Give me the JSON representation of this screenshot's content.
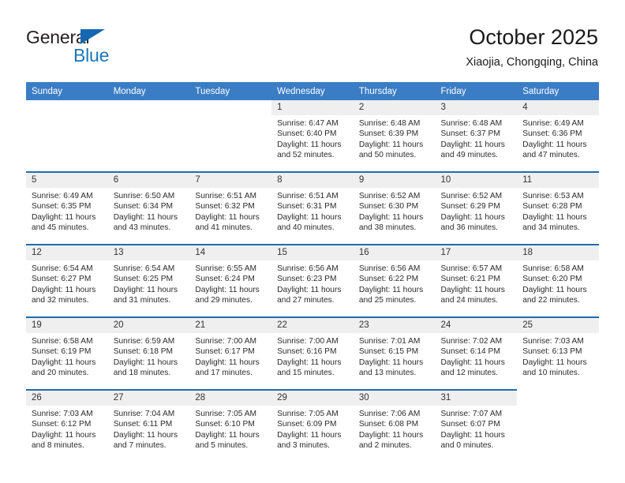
{
  "brand": {
    "name_part1": "General",
    "name_part2": "Blue",
    "triangle_color": "#1667b2",
    "blue_color": "#1b75bb"
  },
  "header": {
    "title": "October 2025",
    "location": "Xiaojia, Chongqing, China"
  },
  "theme": {
    "header_row_bg": "#3b7dc4",
    "week_divider": "#1f6cb0",
    "day_number_bg": "#efefef",
    "text": "#2b2b2b"
  },
  "weekday_headers": [
    "Sunday",
    "Monday",
    "Tuesday",
    "Wednesday",
    "Thursday",
    "Friday",
    "Saturday"
  ],
  "weeks": [
    [
      {
        "empty": true
      },
      {
        "empty": true
      },
      {
        "empty": true
      },
      {
        "day": "1",
        "sunrise": "Sunrise: 6:47 AM",
        "sunset": "Sunset: 6:40 PM",
        "daylight_line1": "Daylight: 11 hours",
        "daylight_line2": "and 52 minutes."
      },
      {
        "day": "2",
        "sunrise": "Sunrise: 6:48 AM",
        "sunset": "Sunset: 6:39 PM",
        "daylight_line1": "Daylight: 11 hours",
        "daylight_line2": "and 50 minutes."
      },
      {
        "day": "3",
        "sunrise": "Sunrise: 6:48 AM",
        "sunset": "Sunset: 6:37 PM",
        "daylight_line1": "Daylight: 11 hours",
        "daylight_line2": "and 49 minutes."
      },
      {
        "day": "4",
        "sunrise": "Sunrise: 6:49 AM",
        "sunset": "Sunset: 6:36 PM",
        "daylight_line1": "Daylight: 11 hours",
        "daylight_line2": "and 47 minutes."
      }
    ],
    [
      {
        "day": "5",
        "sunrise": "Sunrise: 6:49 AM",
        "sunset": "Sunset: 6:35 PM",
        "daylight_line1": "Daylight: 11 hours",
        "daylight_line2": "and 45 minutes."
      },
      {
        "day": "6",
        "sunrise": "Sunrise: 6:50 AM",
        "sunset": "Sunset: 6:34 PM",
        "daylight_line1": "Daylight: 11 hours",
        "daylight_line2": "and 43 minutes."
      },
      {
        "day": "7",
        "sunrise": "Sunrise: 6:51 AM",
        "sunset": "Sunset: 6:32 PM",
        "daylight_line1": "Daylight: 11 hours",
        "daylight_line2": "and 41 minutes."
      },
      {
        "day": "8",
        "sunrise": "Sunrise: 6:51 AM",
        "sunset": "Sunset: 6:31 PM",
        "daylight_line1": "Daylight: 11 hours",
        "daylight_line2": "and 40 minutes."
      },
      {
        "day": "9",
        "sunrise": "Sunrise: 6:52 AM",
        "sunset": "Sunset: 6:30 PM",
        "daylight_line1": "Daylight: 11 hours",
        "daylight_line2": "and 38 minutes."
      },
      {
        "day": "10",
        "sunrise": "Sunrise: 6:52 AM",
        "sunset": "Sunset: 6:29 PM",
        "daylight_line1": "Daylight: 11 hours",
        "daylight_line2": "and 36 minutes."
      },
      {
        "day": "11",
        "sunrise": "Sunrise: 6:53 AM",
        "sunset": "Sunset: 6:28 PM",
        "daylight_line1": "Daylight: 11 hours",
        "daylight_line2": "and 34 minutes."
      }
    ],
    [
      {
        "day": "12",
        "sunrise": "Sunrise: 6:54 AM",
        "sunset": "Sunset: 6:27 PM",
        "daylight_line1": "Daylight: 11 hours",
        "daylight_line2": "and 32 minutes."
      },
      {
        "day": "13",
        "sunrise": "Sunrise: 6:54 AM",
        "sunset": "Sunset: 6:25 PM",
        "daylight_line1": "Daylight: 11 hours",
        "daylight_line2": "and 31 minutes."
      },
      {
        "day": "14",
        "sunrise": "Sunrise: 6:55 AM",
        "sunset": "Sunset: 6:24 PM",
        "daylight_line1": "Daylight: 11 hours",
        "daylight_line2": "and 29 minutes."
      },
      {
        "day": "15",
        "sunrise": "Sunrise: 6:56 AM",
        "sunset": "Sunset: 6:23 PM",
        "daylight_line1": "Daylight: 11 hours",
        "daylight_line2": "and 27 minutes."
      },
      {
        "day": "16",
        "sunrise": "Sunrise: 6:56 AM",
        "sunset": "Sunset: 6:22 PM",
        "daylight_line1": "Daylight: 11 hours",
        "daylight_line2": "and 25 minutes."
      },
      {
        "day": "17",
        "sunrise": "Sunrise: 6:57 AM",
        "sunset": "Sunset: 6:21 PM",
        "daylight_line1": "Daylight: 11 hours",
        "daylight_line2": "and 24 minutes."
      },
      {
        "day": "18",
        "sunrise": "Sunrise: 6:58 AM",
        "sunset": "Sunset: 6:20 PM",
        "daylight_line1": "Daylight: 11 hours",
        "daylight_line2": "and 22 minutes."
      }
    ],
    [
      {
        "day": "19",
        "sunrise": "Sunrise: 6:58 AM",
        "sunset": "Sunset: 6:19 PM",
        "daylight_line1": "Daylight: 11 hours",
        "daylight_line2": "and 20 minutes."
      },
      {
        "day": "20",
        "sunrise": "Sunrise: 6:59 AM",
        "sunset": "Sunset: 6:18 PM",
        "daylight_line1": "Daylight: 11 hours",
        "daylight_line2": "and 18 minutes."
      },
      {
        "day": "21",
        "sunrise": "Sunrise: 7:00 AM",
        "sunset": "Sunset: 6:17 PM",
        "daylight_line1": "Daylight: 11 hours",
        "daylight_line2": "and 17 minutes."
      },
      {
        "day": "22",
        "sunrise": "Sunrise: 7:00 AM",
        "sunset": "Sunset: 6:16 PM",
        "daylight_line1": "Daylight: 11 hours",
        "daylight_line2": "and 15 minutes."
      },
      {
        "day": "23",
        "sunrise": "Sunrise: 7:01 AM",
        "sunset": "Sunset: 6:15 PM",
        "daylight_line1": "Daylight: 11 hours",
        "daylight_line2": "and 13 minutes."
      },
      {
        "day": "24",
        "sunrise": "Sunrise: 7:02 AM",
        "sunset": "Sunset: 6:14 PM",
        "daylight_line1": "Daylight: 11 hours",
        "daylight_line2": "and 12 minutes."
      },
      {
        "day": "25",
        "sunrise": "Sunrise: 7:03 AM",
        "sunset": "Sunset: 6:13 PM",
        "daylight_line1": "Daylight: 11 hours",
        "daylight_line2": "and 10 minutes."
      }
    ],
    [
      {
        "day": "26",
        "sunrise": "Sunrise: 7:03 AM",
        "sunset": "Sunset: 6:12 PM",
        "daylight_line1": "Daylight: 11 hours",
        "daylight_line2": "and 8 minutes."
      },
      {
        "day": "27",
        "sunrise": "Sunrise: 7:04 AM",
        "sunset": "Sunset: 6:11 PM",
        "daylight_line1": "Daylight: 11 hours",
        "daylight_line2": "and 7 minutes."
      },
      {
        "day": "28",
        "sunrise": "Sunrise: 7:05 AM",
        "sunset": "Sunset: 6:10 PM",
        "daylight_line1": "Daylight: 11 hours",
        "daylight_line2": "and 5 minutes."
      },
      {
        "day": "29",
        "sunrise": "Sunrise: 7:05 AM",
        "sunset": "Sunset: 6:09 PM",
        "daylight_line1": "Daylight: 11 hours",
        "daylight_line2": "and 3 minutes."
      },
      {
        "day": "30",
        "sunrise": "Sunrise: 7:06 AM",
        "sunset": "Sunset: 6:08 PM",
        "daylight_line1": "Daylight: 11 hours",
        "daylight_line2": "and 2 minutes."
      },
      {
        "day": "31",
        "sunrise": "Sunrise: 7:07 AM",
        "sunset": "Sunset: 6:07 PM",
        "daylight_line1": "Daylight: 11 hours",
        "daylight_line2": "and 0 minutes."
      },
      {
        "blank": true
      }
    ]
  ]
}
